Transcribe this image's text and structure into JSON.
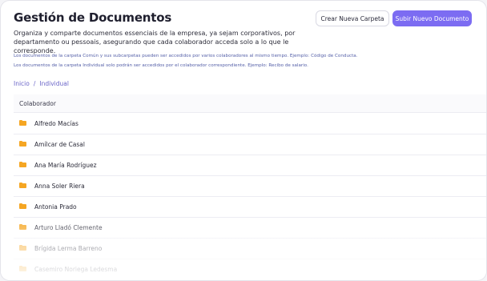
{
  "header": {
    "title": "Gestión de Documentos",
    "create_folder_label": "Crear Nueva Carpeta",
    "upload_document_label": "Subir Nuevo Documento"
  },
  "description": "Organiza y comparte documentos essenciais de la empresa, ya sejam corporativos, por departamento ou pessoais, asegurando que cada colaborador acceda solo a lo que le corresponde.",
  "notes": [
    "Los documentos de la carpeta Común y sus subcarpetas pueden ser accedidos por varios colaboradores al mismo tiempo. Ejemplo: Código de Conducta.",
    "Los documentos de la carpeta Individual solo podrán ser accedidos por el colaborador correspondiente. Ejemplo: Recibo de salario."
  ],
  "breadcrumb": {
    "root": "Inicio",
    "separator": "/",
    "current": "Individual"
  },
  "table": {
    "column_header": "Colaborador",
    "rows": [
      "Alfredo Macías",
      "Amílcar de Casal",
      "Ana María Rodríguez",
      "Anna Soler Riera",
      "Antonia Prado",
      "Arturo Lladó Clemente",
      "Brígida Lerma Barreno",
      "Casemiro Noriega Ledesma"
    ]
  },
  "colors": {
    "accent": "#7c6cf2",
    "folder": "#f5a623",
    "link": "#6a65c8"
  }
}
